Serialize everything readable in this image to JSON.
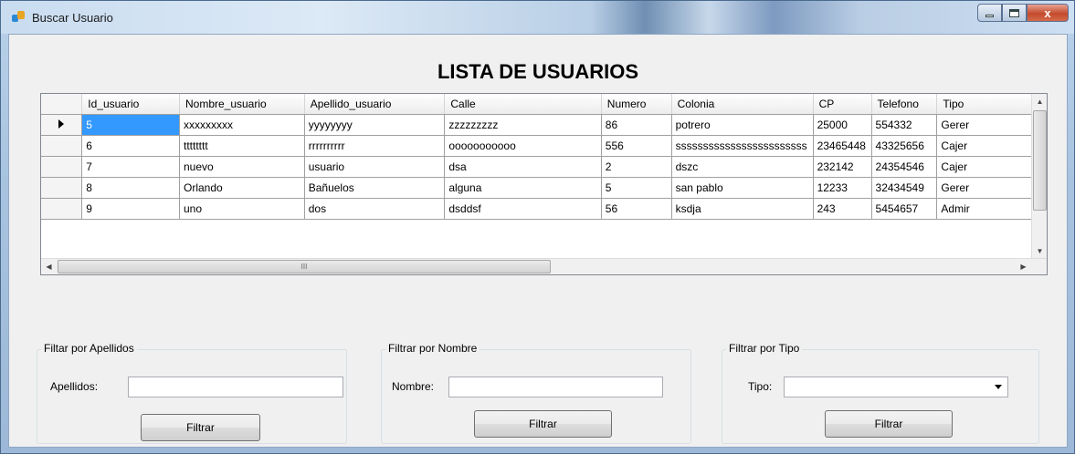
{
  "window": {
    "title": "Buscar Usuario",
    "close_glyph": "x"
  },
  "heading": "LISTA DE USUARIOS",
  "grid": {
    "columns": [
      "Id_usuario",
      "Nombre_usuario",
      "Apellido_usuario",
      "Calle",
      "Numero",
      "Colonia",
      "CP",
      "Telefono",
      "Tipo"
    ],
    "rows": [
      [
        "5",
        "xxxxxxxxx",
        "yyyyyyyy",
        "zzzzzzzzz",
        "86",
        "potrero",
        "25000",
        "554332",
        "Gerer"
      ],
      [
        "6",
        "tttttttt",
        "rrrrrrrrrr",
        "ooooooooooo",
        "556",
        "ssssssssssssssssssssssss",
        "23465448",
        "43325656",
        "Cajer"
      ],
      [
        "7",
        "nuevo",
        "usuario",
        "dsa",
        "2",
        "dszc",
        "232142",
        "24354546",
        "Cajer"
      ],
      [
        "8",
        "Orlando",
        "Bañuelos",
        "alguna",
        "5",
        "san pablo",
        "12233",
        "32434549",
        "Gerer"
      ],
      [
        "9",
        "uno",
        "dos",
        "dsddsf",
        "56",
        "ksdja",
        "243",
        "5454657",
        "Admir"
      ]
    ],
    "scroll_marker": "III"
  },
  "filters": {
    "apellidos": {
      "legend": "Filtar por Apellidos",
      "label": "Apellidos:",
      "value": "",
      "button": "Filtrar"
    },
    "nombre": {
      "legend": "Filtrar por Nombre",
      "label": "Nombre:",
      "value": "",
      "button": "Filtrar"
    },
    "tipo": {
      "legend": "Filtrar por Tipo",
      "label": "Tipo:",
      "value": "",
      "button": "Filtrar"
    }
  }
}
